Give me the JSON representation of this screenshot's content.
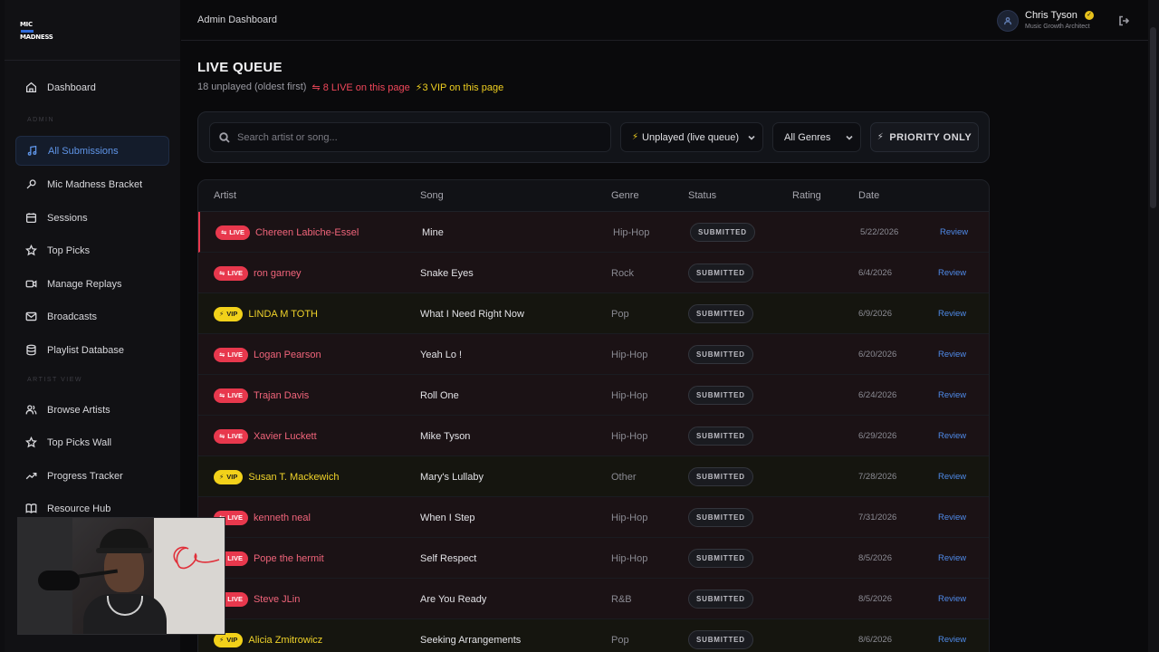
{
  "app": {
    "logo_text": "MIC MADNESS",
    "header_title": "Admin Dashboard"
  },
  "user": {
    "name": "Chris Tyson",
    "role": "Music Growth Architect"
  },
  "sidebar": {
    "sections": {
      "admin": "ADMIN",
      "artist_view": "ARTIST VIEW"
    },
    "items": [
      {
        "label": "Dashboard",
        "icon": "home-icon"
      },
      {
        "label": "All Submissions",
        "icon": "music-note-icon",
        "active": true
      },
      {
        "label": "Mic Madness Bracket",
        "icon": "microphone-icon"
      },
      {
        "label": "Sessions",
        "icon": "calendar-icon"
      },
      {
        "label": "Top Picks",
        "icon": "star-icon"
      },
      {
        "label": "Manage Replays",
        "icon": "video-icon"
      },
      {
        "label": "Broadcasts",
        "icon": "mail-icon"
      },
      {
        "label": "Playlist Database",
        "icon": "database-icon"
      },
      {
        "label": "Browse Artists",
        "icon": "users-icon"
      },
      {
        "label": "Top Picks Wall",
        "icon": "star-icon"
      },
      {
        "label": "Progress Tracker",
        "icon": "trending-up-icon"
      },
      {
        "label": "Resource Hub",
        "icon": "book-icon"
      }
    ]
  },
  "page": {
    "title": "LIVE QUEUE",
    "summary": "18 unplayed (oldest first)",
    "live_summary": "8 LIVE on this page",
    "vip_summary": "3 VIP on this page"
  },
  "filters": {
    "search_placeholder": "Search artist or song...",
    "status_filter": "Unplayed (live queue)",
    "genre_filter": "All Genres",
    "priority_label": "PRIORITY ONLY"
  },
  "table": {
    "columns": [
      "Artist",
      "Song",
      "Genre",
      "Status",
      "Rating",
      "Date"
    ],
    "badge_live": "LIVE",
    "badge_vip": "VIP",
    "action_label": "Review",
    "rows": [
      {
        "type": "live",
        "artist": "Chereen Labiche-Essel",
        "song": "Mine",
        "genre": "Hip-Hop",
        "status": "SUBMITTED",
        "rating": "",
        "date": "5/22/2026"
      },
      {
        "type": "live",
        "artist": "ron garney",
        "song": "Snake Eyes",
        "genre": "Rock",
        "status": "SUBMITTED",
        "rating": "",
        "date": "6/4/2026"
      },
      {
        "type": "vip",
        "artist": "LINDA M TOTH",
        "song": "What I Need Right Now",
        "genre": "Pop",
        "status": "SUBMITTED",
        "rating": "",
        "date": "6/9/2026"
      },
      {
        "type": "live",
        "artist": "Logan Pearson",
        "song": "Yeah Lo !",
        "genre": "Hip-Hop",
        "status": "SUBMITTED",
        "rating": "",
        "date": "6/20/2026"
      },
      {
        "type": "live",
        "artist": "Trajan Davis",
        "song": "Roll One",
        "genre": "Hip-Hop",
        "status": "SUBMITTED",
        "rating": "",
        "date": "6/24/2026"
      },
      {
        "type": "live",
        "artist": "Xavier Luckett",
        "song": "Mike Tyson",
        "genre": "Hip-Hop",
        "status": "SUBMITTED",
        "rating": "",
        "date": "6/29/2026"
      },
      {
        "type": "vip",
        "artist": "Susan T. Mackewich",
        "song": "Mary's Lullaby",
        "genre": "Other",
        "status": "SUBMITTED",
        "rating": "",
        "date": "7/28/2026"
      },
      {
        "type": "live",
        "artist": "kenneth neal",
        "song": "When I Step",
        "genre": "Hip-Hop",
        "status": "SUBMITTED",
        "rating": "",
        "date": "7/31/2026"
      },
      {
        "type": "live",
        "artist": "Pope the hermit",
        "song": "Self Respect",
        "genre": "Hip-Hop",
        "status": "SUBMITTED",
        "rating": "",
        "date": "8/5/2026"
      },
      {
        "type": "live",
        "artist": "Steve JLin",
        "song": "Are You Ready",
        "genre": "R&B",
        "status": "SUBMITTED",
        "rating": "",
        "date": "8/5/2026"
      },
      {
        "type": "vip",
        "artist": "Alicia Zmitrowicz",
        "song": "Seeking Arrangements",
        "genre": "Pop",
        "status": "SUBMITTED",
        "rating": "",
        "date": "8/6/2026"
      }
    ]
  },
  "colors": {
    "accent": "#4f8ae8",
    "live": "#e8384d",
    "vip": "#f2d11a",
    "background": "#0a0a0c"
  }
}
